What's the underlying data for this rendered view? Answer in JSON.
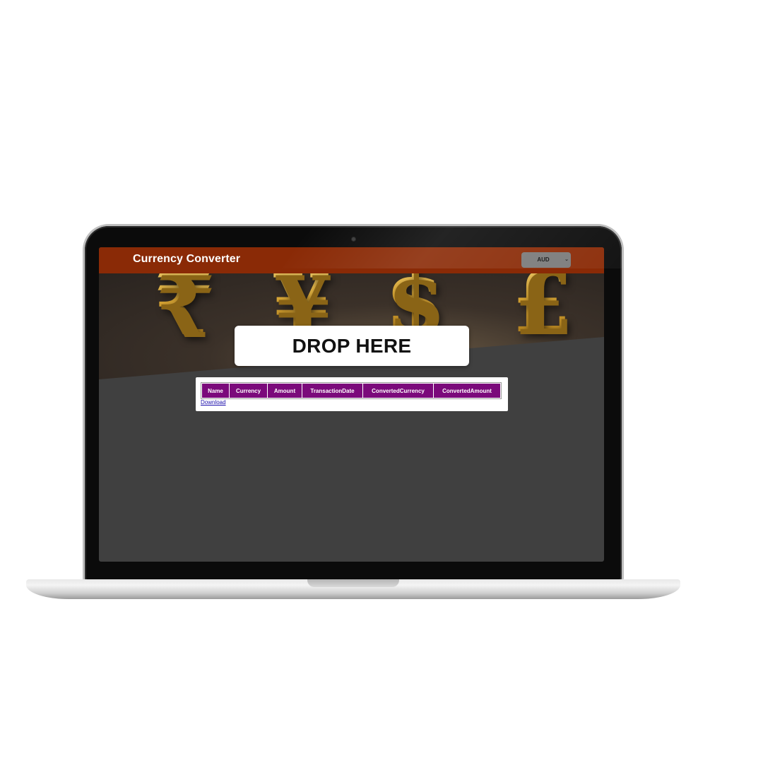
{
  "app": {
    "title": "Currency Converter"
  },
  "currency_select": {
    "selected": "AUD",
    "chevron_icon": "chevron-down-icon"
  },
  "hero": {
    "symbols": [
      "₹",
      "¥",
      "$",
      "£"
    ]
  },
  "drop_zone": {
    "label": "DROP HERE"
  },
  "table": {
    "columns": [
      "Name",
      "Currency",
      "Amount",
      "TransactionDate",
      "ConvertedCurrency",
      "ConvertedAmount"
    ],
    "header_color": "#7b0a7b"
  },
  "download": {
    "label": "Download"
  },
  "colors": {
    "header_bar": "#8a2a06",
    "screen_bg": "#404040"
  }
}
